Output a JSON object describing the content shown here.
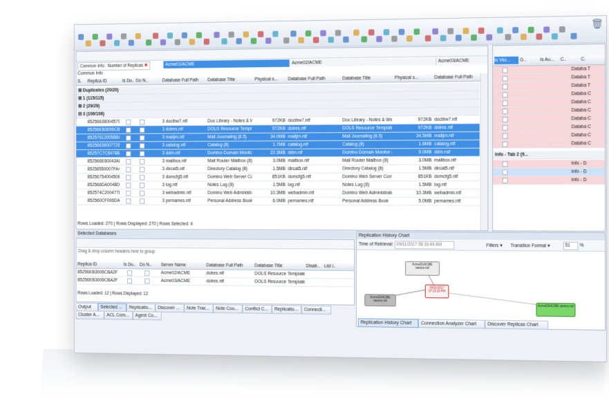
{
  "grid": {
    "group_chip": "Common Info : Number of Replicas",
    "servers": [
      "Acme01/ACME",
      "Acme02/ACME",
      "Acme03/ACME"
    ],
    "common_info": "Common Info",
    "columns": [
      "S.",
      "Replica ID",
      "Is Du..",
      "Do N..",
      "Database Full Path",
      "Database Title",
      "Physical s...",
      "Database Full Path",
      "Database Title",
      "Physical s...",
      "Database Full Path"
    ],
    "groups": [
      "Duplicates (20/20)",
      "1 (115/115)",
      "2 (29/29)",
      "3 (106/106)"
    ],
    "rows": [
      {
        "rid": "852566360045795",
        "n": "3",
        "p1": "doclbw7.ntf",
        "t1": "Doc Library - Notes & Web",
        "s1": "972KB",
        "p2": "doclbw7.ntf",
        "t2": "Doc Library - Notes & Web",
        "s2": "972KB",
        "p3": "doclbw7.ntf",
        "sel": false
      },
      {
        "rid": "85256EB3006CBA2F",
        "n": "3",
        "p1": "dolres.ntf",
        "t1": "DOLS Resource Template",
        "s1": "972KB",
        "p2": "dolres.ntf",
        "t2": "DOLS Resource Template",
        "s2": "972KB",
        "p3": "dolres.ntf",
        "sel": true
      },
      {
        "rid": "85257612005B8AFD",
        "n": "3",
        "p1": "mailjrn.ntf",
        "t1": "Mail Journaling (8.5)",
        "s1": "34.0MB",
        "p2": "mailjrn.ntf",
        "t2": "Mail Journaling (8.5)",
        "s2": "34.5MB",
        "p3": "mailjrn.ntf",
        "sel": true
      },
      {
        "rid": "852566360077289",
        "n": "3",
        "p1": "catalog.ntf",
        "t1": "Catalog (8)",
        "s1": "1.7MB",
        "p2": "catalog.ntf",
        "t2": "Catalog (8)",
        "s2": "1.6MB",
        "p3": "catalog.ntf",
        "sel": true
      },
      {
        "rid": "85257C7C6478B78F",
        "n": "3",
        "p1": "ddm.ntf",
        "t1": "Domino Domain Monitor (8",
        "s1": "22.3MB",
        "p2": "ddm.ntf",
        "t2": "Domino Domain Monitor (8",
        "s2": "9.0MB",
        "p3": "ddm.nsf",
        "sel": true
      },
      {
        "rid": "852566E60043A803",
        "n": "3",
        "p1": "mailbox.ntf",
        "t1": "Mail Router Mailbox (8)",
        "s1": "3.0MB",
        "p2": "mailbox.ntf",
        "t2": "Mail Router Mailbox (8)",
        "s2": "3.0MB",
        "p3": "mailbox.ntf",
        "sel": false
      },
      {
        "rid": "85256550007FA4C",
        "n": "3",
        "p1": "dircat5.ntf",
        "t1": "Directory Catalog (8)",
        "s1": "1.5MB",
        "p2": "dircat5.ntf",
        "t2": "Directory Catalog (8)",
        "s2": "1.5MB",
        "p3": "dircat5.ntf",
        "sel": false
      },
      {
        "rid": "85256754004508DC",
        "n": "3",
        "p1": "domcfg5.ntf",
        "t1": "Domino Web Server Config",
        "s1": "851KB",
        "p2": "domcfg5.ntf",
        "t2": "Domino Web Server Config",
        "s2": "851KB",
        "p3": "domcfg5.ntf",
        "sel": false
      },
      {
        "rid": "852566DA0048DB",
        "n": "3",
        "p1": "log.ntf",
        "t1": "Notes Log (8)",
        "s1": "1.5MB",
        "p2": "log.ntf",
        "t2": "Notes Log (8)",
        "s2": "1.5MB",
        "p3": "log.ntf",
        "sel": false
      },
      {
        "rid": "852574C200477845",
        "n": "3",
        "p1": "webadmin.ntf",
        "t1": "Domino Web Administrator",
        "s1": "10.3MB",
        "p2": "webadmin.ntf",
        "t2": "Domino Web Administrator",
        "s2": "10.3MB",
        "p3": "webadmin.ntf",
        "sel": false
      },
      {
        "rid": "852560CF006DA061",
        "n": "3",
        "p1": "pernames.ntf",
        "t1": "Personal Address Book",
        "s1": "6.0MB",
        "p2": "pernames.ntf",
        "t2": "Personal Address Book",
        "s2": "5.0MB",
        "p3": "pernames.ntf",
        "sel": false
      }
    ],
    "status": "Rows Loaded: 270 | Rows Displayed: 270 | Rows Selected: 4"
  },
  "right": {
    "columns": [
      "Is Visi...",
      "G..",
      "Is Au...",
      "C..",
      "C."
    ],
    "cells": [
      "Databa T",
      "Databa T",
      "Databa T",
      "Databa C",
      "Databa C",
      "Databa C",
      "Databa C",
      "Databa C",
      "Databa C",
      "Databa C"
    ],
    "tab_group": "Info - Tab 2 (9...",
    "info_rows": [
      "Info - D",
      "Info - D",
      "Info - D"
    ]
  },
  "selected": {
    "title": "Selected Databases",
    "drag_hint": "Drag & drop column headers here to group",
    "columns": [
      "Replica ID",
      "Is Du..",
      "Do N..",
      "Server Name",
      "Database Full Path",
      "Database Title",
      "Disab..",
      "List i.."
    ],
    "rows": [
      {
        "rid": "85256EB3006CBA2F",
        "server": "Acme02/ACME",
        "path": "dolres.ntf",
        "title": "DOLS Resource Template"
      },
      {
        "rid": "85256EB3006CBA2F",
        "server": "Acme03/ACME",
        "path": "dolres.ntf",
        "title": "DOLS Resource Template"
      }
    ],
    "status": "Rows Loaded: 12 | Rows Displayed: 12"
  },
  "bottom_tabs": [
    "Output",
    "Selected ...",
    "Replicatio...",
    "Discover ...",
    "Note Trac...",
    "Note Cou...",
    "Conflict C...",
    "Replicatio...",
    "Connecti...",
    "Cluster A...",
    "ACL Com...",
    "Agent Co..."
  ],
  "chart": {
    "title": "Replication History Chart",
    "retrieval_label": "Time of Retrieval:",
    "retrieval_value": "09/11/2017 08:16:49 AM",
    "filters": "Filters ▾",
    "transition": "Transition Format ▾",
    "zoom": "51",
    "zoom_unit": "%",
    "nodes": [
      "Acme01/ACME names.nsf",
      "09/11/2017 07:23:15 PM",
      "Acme02/ACME names.nsf",
      "Acme03/ACME names.nsf"
    ],
    "tabs": [
      "Replication History Chart",
      "Connection Analyzer Chart",
      "Discover Replicas Chart"
    ]
  },
  "colors": {
    "selection": "#3f8fe6",
    "right_pink": "#f7d7d9",
    "node_green": "#7ad96a"
  }
}
